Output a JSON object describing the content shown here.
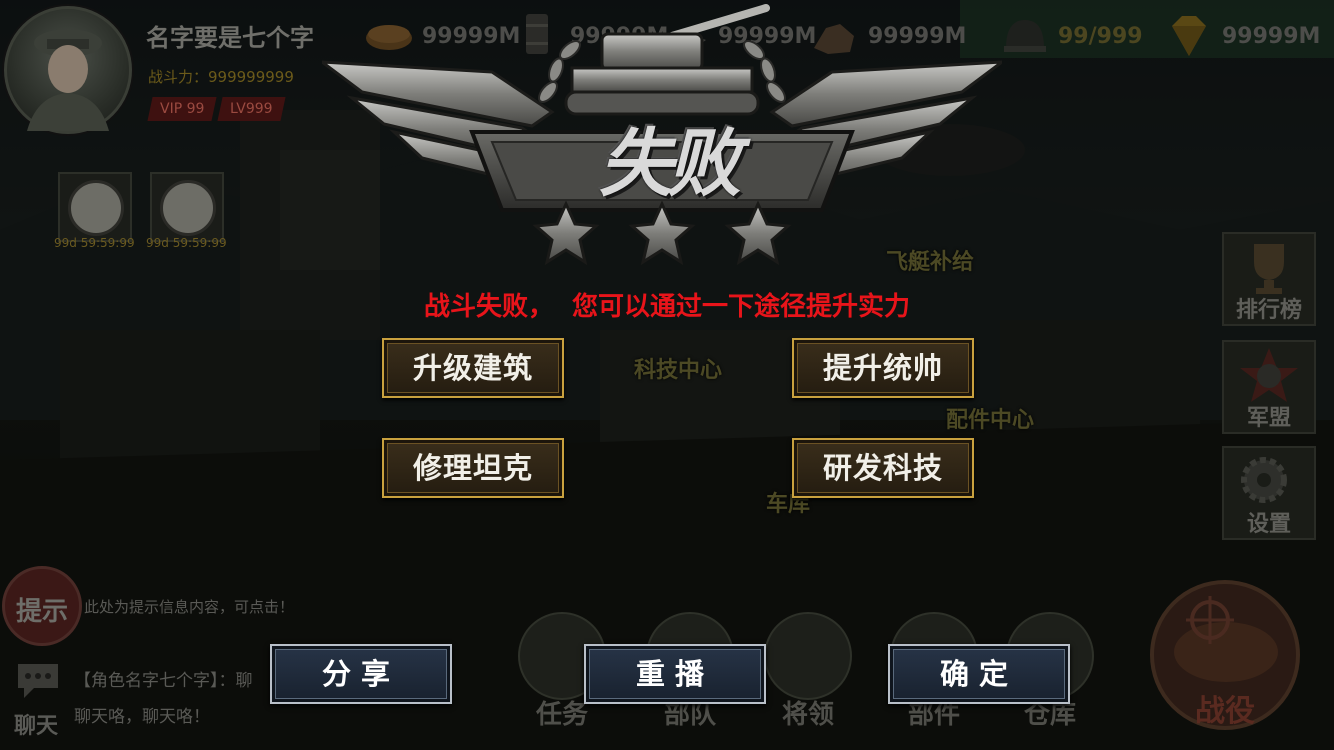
{
  "player": {
    "name": "名字要是七个字",
    "power": "战斗力：999999999",
    "vip": "VIP 99",
    "level": "LV999"
  },
  "resources": [
    {
      "icon": "bread-icon",
      "value": "99999M"
    },
    {
      "icon": "oil-barrel-icon",
      "value": "99999M"
    },
    {
      "icon": "steel-ingot-icon",
      "value": "99999M"
    },
    {
      "icon": "ore-icon",
      "value": "99999M"
    },
    {
      "icon": "helmet-stamina-icon",
      "value": "99/999"
    },
    {
      "icon": "diamond-icon",
      "value": "99999M"
    }
  ],
  "timers": [
    "99d 59:59:99",
    "99d 59:59:99"
  ],
  "map_labels": {
    "airship": "飞艇补给",
    "tech": "科技中心",
    "parts": "配件中心",
    "garage": "车库"
  },
  "side_menu": {
    "rank": "排行榜",
    "alliance": "军盟",
    "settings": "设置"
  },
  "hint": {
    "badge": "提示",
    "text": "此处为提示信息内容，可点击！"
  },
  "chat": {
    "label": "聊天",
    "line1": "【角色名字七个字】：聊",
    "line2": "聊天咯，聊天咯！"
  },
  "bottom_nav": {
    "task": "任务",
    "troops": "部队",
    "generals": "将领",
    "parts": "部件",
    "warehouse": "仓库",
    "battle": "战役"
  },
  "dialog": {
    "title": "失败",
    "subtitle": "战斗失败，  您可以通过一下途径提升实力",
    "options": {
      "upgrade_building": "升级建筑",
      "improve_commander": "提升统帅",
      "repair_tank": "修理坦克",
      "research_tech": "研发科技"
    },
    "buttons": {
      "share": "分享",
      "replay": "重播",
      "confirm": "确定"
    }
  },
  "colors": {
    "subtitle_red": "#e8141a",
    "option_gold_border": "#c9a13e",
    "button_blue": "#273447"
  }
}
